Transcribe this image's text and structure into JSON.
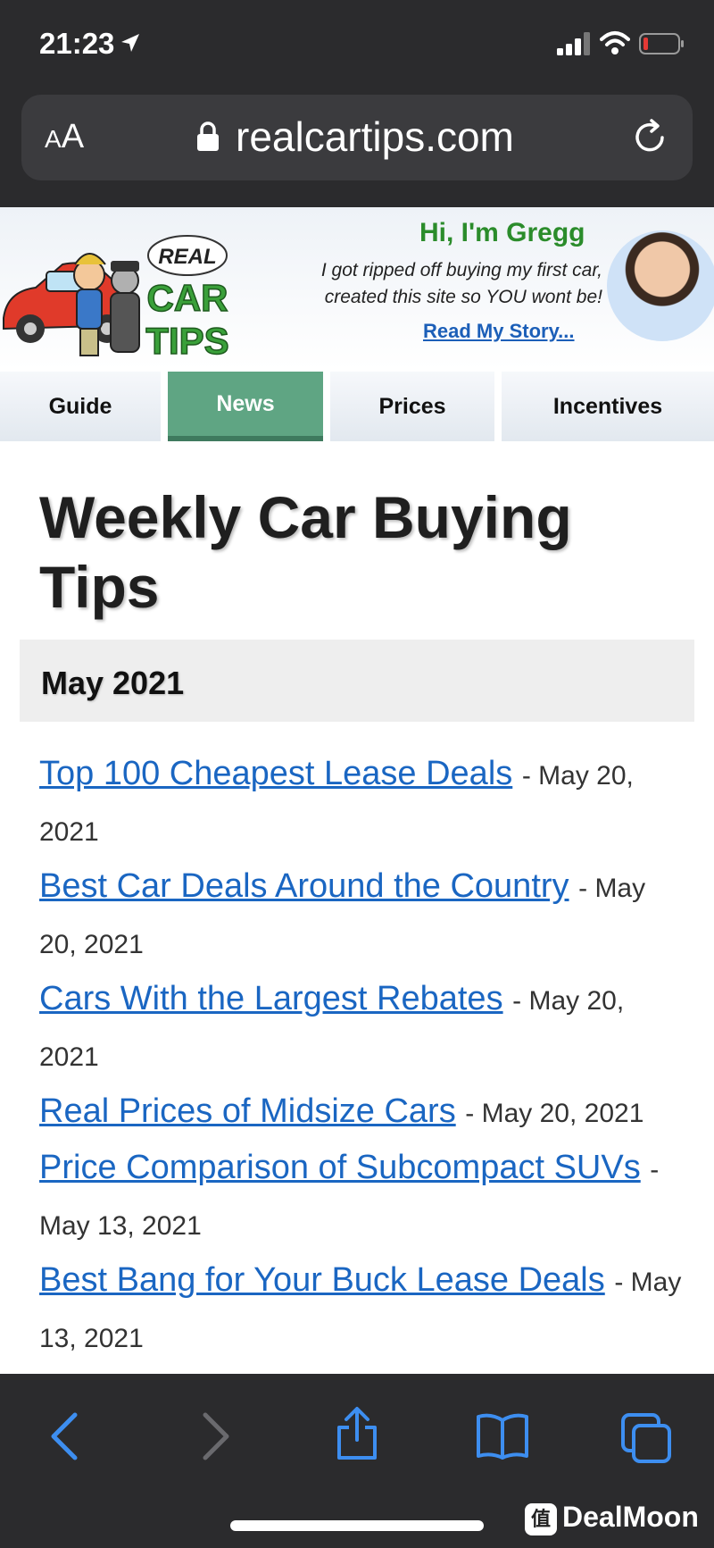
{
  "status_bar": {
    "time": "21:23"
  },
  "browser": {
    "aa_label": [
      "A",
      "A"
    ],
    "url": "realcartips.com"
  },
  "site_header": {
    "logo_text": [
      "REAL",
      "CAR",
      "TIPS"
    ],
    "greeting": "Hi, I'm Gregg",
    "tagline_lines": [
      "I got ripped off buying my first car,",
      "created this site so YOU wont be!"
    ],
    "story_link": "Read My Story..."
  },
  "tabs": [
    {
      "label": "Guide",
      "active": false
    },
    {
      "label": "News",
      "active": true
    },
    {
      "label": "Prices",
      "active": false
    },
    {
      "label": "Incentives",
      "active": false
    }
  ],
  "page_title": "Weekly Car Buying Tips",
  "month_heading": "May 2021",
  "articles": [
    {
      "title": "Top 100 Cheapest Lease Deals",
      "date": "May 20, 2021"
    },
    {
      "title": "Best Car Deals Around the Country",
      "date": "May 20, 2021"
    },
    {
      "title": "Cars With the Largest Rebates",
      "date": "May 20, 2021"
    },
    {
      "title": "Real Prices of Midsize Cars",
      "date": "May 20, 2021"
    },
    {
      "title": "Price Comparison of Subcompact SUVs",
      "date": "May 13, 2021"
    },
    {
      "title": "Best Bang for Your Buck Lease Deals",
      "date": "May 13, 2021"
    }
  ],
  "separator": "-",
  "watermark": "DealMoon",
  "watermark_badge": "值"
}
